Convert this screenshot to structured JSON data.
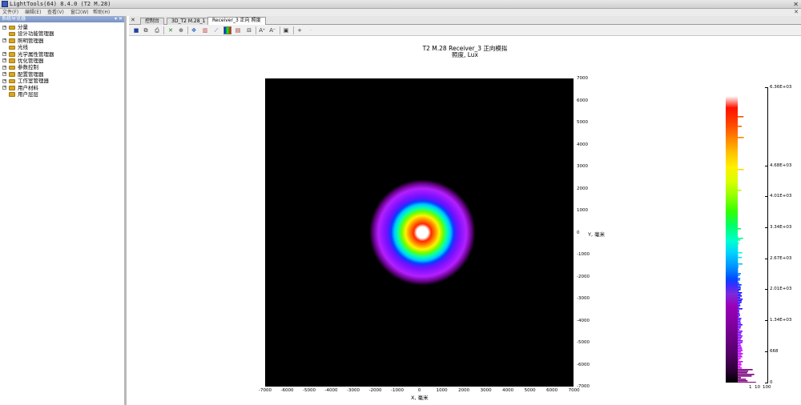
{
  "window": {
    "title": "LightTools(64) 8.4.0  (T2 M.28)"
  },
  "menu": [
    "文件(F)",
    "编辑(E)",
    "查看(V)",
    "窗口(W)",
    "帮助(H)"
  ],
  "navigator": {
    "header": "系统导览器",
    "items": [
      {
        "label": "分量",
        "expandable": true
      },
      {
        "label": "设计功能管理器",
        "expandable": false
      },
      {
        "label": "照明管理器",
        "expandable": true
      },
      {
        "label": "光线",
        "expandable": false
      },
      {
        "label": "光学属性管理器",
        "expandable": true
      },
      {
        "label": "优化管理器",
        "expandable": true
      },
      {
        "label": "参数控制",
        "expandable": true
      },
      {
        "label": "配置管理器",
        "expandable": true
      },
      {
        "label": "工作室管理器",
        "expandable": true
      },
      {
        "label": "用户材料",
        "expandable": true
      },
      {
        "label": "用户层层",
        "expandable": false
      }
    ]
  },
  "tabs": [
    {
      "label": "控制台",
      "active": false
    },
    {
      "label": "3D_T2 M.28_1",
      "active": false
    },
    {
      "label": "Receiver_3 正向 照度",
      "active": true
    }
  ],
  "plot": {
    "title": "T2 M.28 Receiver_3 正向模拟",
    "subtitle": "照度, Lux",
    "x_ticks": [
      "-7000",
      "-6000",
      "-5000",
      "-4000",
      "-3000",
      "-2000",
      "-1000",
      "0",
      "1000",
      "2000",
      "3000",
      "4000",
      "5000",
      "6000",
      "7000"
    ],
    "y_ticks": [
      "7000",
      "6000",
      "5000",
      "4000",
      "3000",
      "2000",
      "1000",
      "0",
      "-1000",
      "-2000",
      "-3000",
      "-4000",
      "-5000",
      "-6000",
      "-7000"
    ],
    "x_label": "X, 毫米",
    "y_label": "Y, 毫米",
    "colorbar_ticks": [
      "6.36E+03",
      "4.68E+03",
      "4.01E+03",
      "3.34E+03",
      "2.67E+03",
      "2.01E+03",
      "1.34E+03",
      "668",
      "0"
    ],
    "hist_axis": [
      "1",
      "10",
      "100"
    ]
  },
  "chart_data": {
    "type": "heatmap",
    "title": "T2 M.28 Receiver_3 正向模拟",
    "subtitle": "照度, Lux",
    "xlabel": "X, 毫米",
    "ylabel": "Y, 毫米",
    "xlim": [
      -7000,
      7000
    ],
    "ylim": [
      -7000,
      7000
    ],
    "colorbar_range": [
      0,
      6360
    ],
    "colorbar_ticks": [
      6360,
      4680,
      4010,
      3340,
      2670,
      2010,
      1340,
      668,
      0
    ]
  }
}
